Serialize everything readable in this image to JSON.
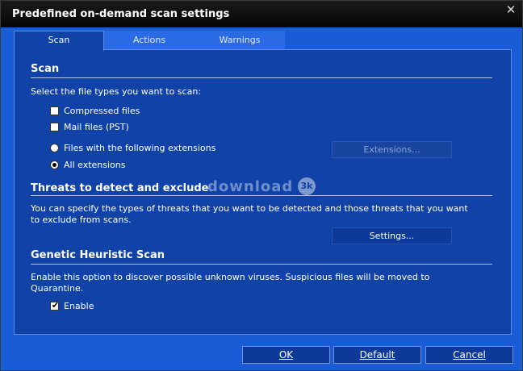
{
  "window": {
    "title": "Predefined on-demand scan settings",
    "close_glyph": "✕"
  },
  "tabs": [
    {
      "label": "Scan",
      "active": true
    },
    {
      "label": "Actions",
      "active": false
    },
    {
      "label": "Warnings",
      "active": false
    }
  ],
  "scan": {
    "title": "Scan",
    "description": "Select the file types you want to scan:",
    "compressed_label": "Compressed files",
    "compressed_checked": false,
    "mail_label": "Mail files (PST)",
    "mail_checked": false,
    "extensions_radio_label": "Files with the following extensions",
    "all_extensions_label": "All extensions",
    "selected_radio": "all_extensions",
    "extensions_button": "Extensions..."
  },
  "threats": {
    "title": "Threats to detect and exclude",
    "description_line1": "You can specify the types of threats that you want to be detected and those threats that you want",
    "description_line2": "to exclude from scans.",
    "settings_button": "Settings..."
  },
  "heuristic": {
    "title": "Genetic Heuristic Scan",
    "description_line1": "Enable this option to discover possible unknown viruses. Suspicious files will be moved to",
    "description_line2": "Quarantine.",
    "enable_label": "Enable",
    "enable_checked": true
  },
  "watermark": {
    "text": "download",
    "badge": "3k"
  },
  "footer": {
    "ok_label": "OK",
    "default_label": "Default",
    "cancel_label": "Cancel"
  },
  "colors": {
    "window_bg": "#1a5cd6",
    "panel_bg": "#1142a7",
    "titlebar_bg": "#0a0a0a",
    "button_bg": "#0d3a98"
  }
}
